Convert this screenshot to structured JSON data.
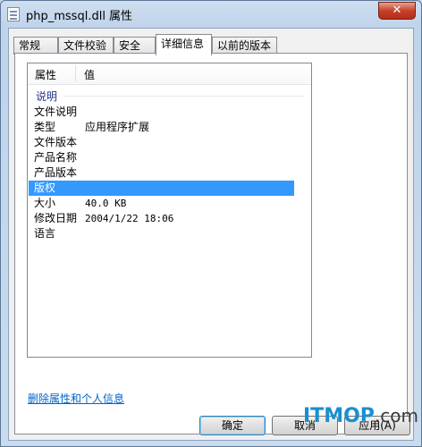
{
  "window": {
    "title": "php_mssql.dll 属性",
    "close_glyph": "✕"
  },
  "tabs": [
    {
      "label": "常规"
    },
    {
      "label": "文件校验"
    },
    {
      "label": "安全"
    },
    {
      "label": "详细信息",
      "active": true
    },
    {
      "label": "以前的版本"
    }
  ],
  "details": {
    "columns": {
      "property": "属性",
      "value": "值"
    },
    "group": "说明",
    "rows": [
      {
        "property": "文件说明",
        "value": ""
      },
      {
        "property": "类型",
        "value": "应用程序扩展"
      },
      {
        "property": "文件版本",
        "value": ""
      },
      {
        "property": "产品名称",
        "value": ""
      },
      {
        "property": "产品版本",
        "value": ""
      },
      {
        "property": "版权",
        "value": "",
        "selected": true
      },
      {
        "property": "大小",
        "value": "40.0 KB"
      },
      {
        "property": "修改日期",
        "value": "2004/1/22 18:06"
      },
      {
        "property": "语言",
        "value": ""
      }
    ]
  },
  "link": {
    "remove_properties": "删除属性和个人信息"
  },
  "buttons": {
    "ok": "确定",
    "cancel": "取消",
    "apply": "应用(A)"
  },
  "watermark": {
    "brand": "ITMOP",
    "suffix": ".com"
  },
  "colors": {
    "selection": "#3399ff",
    "link": "#0066cc",
    "close": "#c7402b"
  }
}
